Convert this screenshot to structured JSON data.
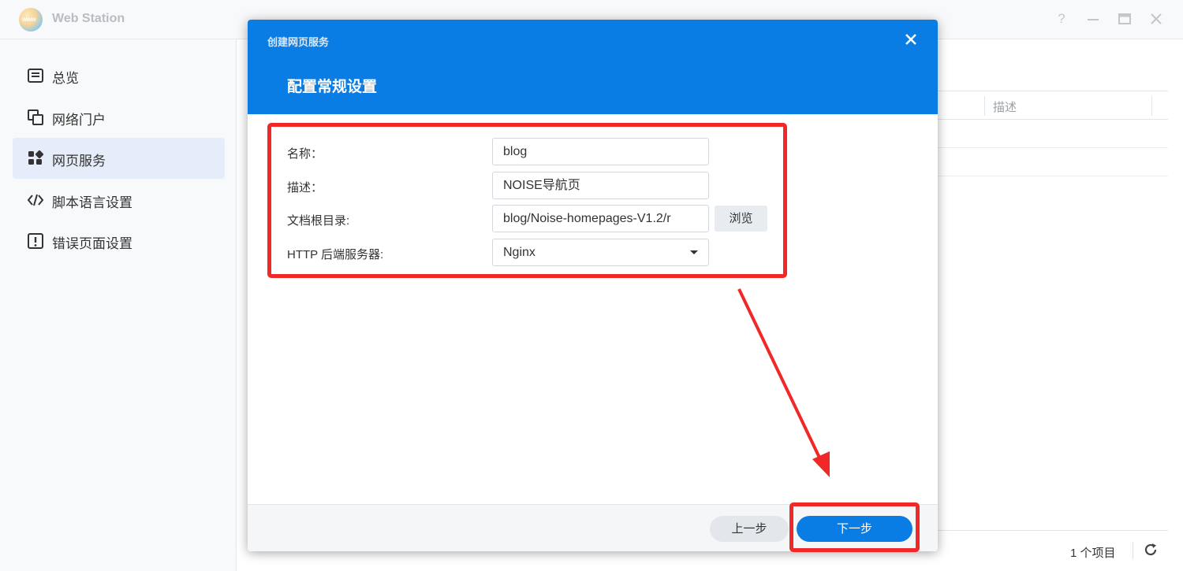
{
  "app": {
    "title": "Web Station",
    "logo_text": "www"
  },
  "window_controls": {
    "help": "?"
  },
  "sidebar": {
    "items": [
      {
        "label": "总览",
        "icon": "overview-icon"
      },
      {
        "label": "网络门户",
        "icon": "portal-icon"
      },
      {
        "label": "网页服务",
        "icon": "web-service-icon",
        "active": true
      },
      {
        "label": "脚本语言设置",
        "icon": "code-icon"
      },
      {
        "label": "错误页面设置",
        "icon": "error-page-icon"
      }
    ]
  },
  "background_table": {
    "column": "描述",
    "item_count": "1 个项目"
  },
  "dialog": {
    "title": "创建网页服务",
    "step_title": "配置常规设置",
    "fields": {
      "name": {
        "label": "名称：",
        "value": "blog"
      },
      "description": {
        "label": "描述：",
        "value": "NOISE导航页"
      },
      "doc_root": {
        "label": "文档根目录:",
        "value": "blog/Noise-homepages-V1.2/r",
        "browse": "浏览"
      },
      "backend": {
        "label": "HTTP 后端服务器:",
        "value": "Nginx"
      }
    },
    "buttons": {
      "prev": "上一步",
      "next": "下一步"
    }
  },
  "annotation_color": "#f02828",
  "accent_color": "#0a7de5"
}
